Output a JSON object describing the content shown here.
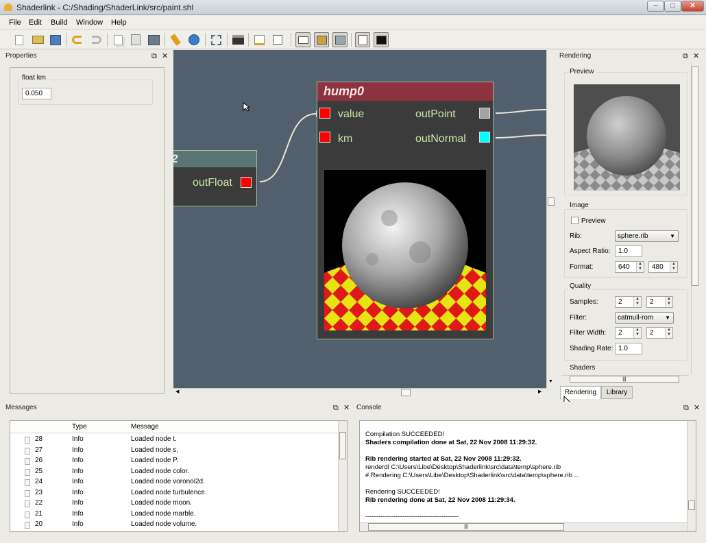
{
  "window": {
    "title": "Shaderlink - C:/Shading/ShaderLink/src/paint.shl"
  },
  "menu": [
    "File",
    "Edit",
    "Build",
    "Window",
    "Help"
  ],
  "toolbar": {
    "icons": [
      "new-file-icon",
      "open-folder-icon",
      "save-icon",
      "undo-icon",
      "redo-icon",
      "copy-icon",
      "paste-icon",
      "delete-icon",
      "clean-brush-icon",
      "globe-icon",
      "fit-view-icon",
      "clapper-icon",
      "edit-note-icon",
      "zoom-region-icon",
      "layout-single-icon",
      "layout-graph-icon",
      "layout-preview-icon",
      "document-icon",
      "terminal-icon"
    ]
  },
  "properties": {
    "title": "Properties",
    "group_label": "float km",
    "value": "0.050"
  },
  "graph": {
    "node_main": {
      "title": "hump0",
      "inputs": [
        "value",
        "km"
      ],
      "outputs": [
        "outPoint",
        "outNormal"
      ]
    },
    "node_left": {
      "title_suffix": "2",
      "output": "outFloat"
    },
    "colors": {
      "canvas": "#525f6d",
      "port_red": "#ff0000",
      "port_gray": "#a3a3a3",
      "port_cyan": "#00ffff",
      "header_main": "#8e3240",
      "header_left": "#5a7575"
    }
  },
  "rendering": {
    "title": "Rendering",
    "preview_label": "Preview",
    "image": {
      "group": "Image",
      "preview_checkbox": "Preview",
      "rib_label": "Rib:",
      "rib_value": "sphere.rib",
      "aspect_label": "Aspect Ratio:",
      "aspect_value": "1.0",
      "format_label": "Format:",
      "format_w": "640",
      "format_h": "480"
    },
    "quality": {
      "group": "Quality",
      "samples_label": "Samples:",
      "samples_x": "2",
      "samples_y": "2",
      "filter_label": "Filter:",
      "filter_value": "catmull-rom",
      "filter_width_label": "Filter Width:",
      "fw_x": "2",
      "fw_y": "2",
      "shading_rate_label": "Shading Rate:",
      "shading_rate_value": "1.0"
    },
    "shaders_group": "Shaders",
    "tabs": [
      "Rendering",
      "Library"
    ]
  },
  "messages": {
    "title": "Messages",
    "columns": [
      "Type",
      "Message"
    ],
    "rows": [
      {
        "id": "28",
        "type": "Info",
        "msg": "Loaded node t."
      },
      {
        "id": "27",
        "type": "Info",
        "msg": "Loaded node s."
      },
      {
        "id": "26",
        "type": "Info",
        "msg": "Loaded node P."
      },
      {
        "id": "25",
        "type": "Info",
        "msg": "Loaded node color."
      },
      {
        "id": "24",
        "type": "Info",
        "msg": "Loaded node voronoi2d."
      },
      {
        "id": "23",
        "type": "Info",
        "msg": "Loaded node turbulence."
      },
      {
        "id": "22",
        "type": "Info",
        "msg": "Loaded node moon."
      },
      {
        "id": "21",
        "type": "Info",
        "msg": "Loaded node marble."
      },
      {
        "id": "20",
        "type": "Info",
        "msg": "Loaded node volume."
      }
    ]
  },
  "console": {
    "title": "Console",
    "lines": [
      {
        "t": "Compilation SUCCEEDED!",
        "bold": false
      },
      {
        "t": "Shaders compilation done at Sat, 22 Nov 2008 11:29:32.",
        "bold": true
      },
      {
        "t": "",
        "bold": false
      },
      {
        "t": "Rib rendering started at Sat, 22 Nov 2008 11:29:32.",
        "bold": true
      },
      {
        "t": "renderdl C:\\Users\\Libe\\Desktop\\Shaderlink\\src\\data\\temp\\sphere.rib",
        "bold": false
      },
      {
        "t": "# Rendering C:\\Users\\Libe\\Desktop\\Shaderlink\\src\\data\\temp\\sphere.rib ...",
        "bold": false
      },
      {
        "t": "",
        "bold": false
      },
      {
        "t": "Rendering SUCCEEDED!",
        "bold": false
      },
      {
        "t": "Rib rendering done at Sat, 22 Nov 2008 11:29:34.",
        "bold": true
      },
      {
        "t": "",
        "bold": false
      },
      {
        "t": "-------------------------------------------",
        "bold": false
      }
    ]
  }
}
